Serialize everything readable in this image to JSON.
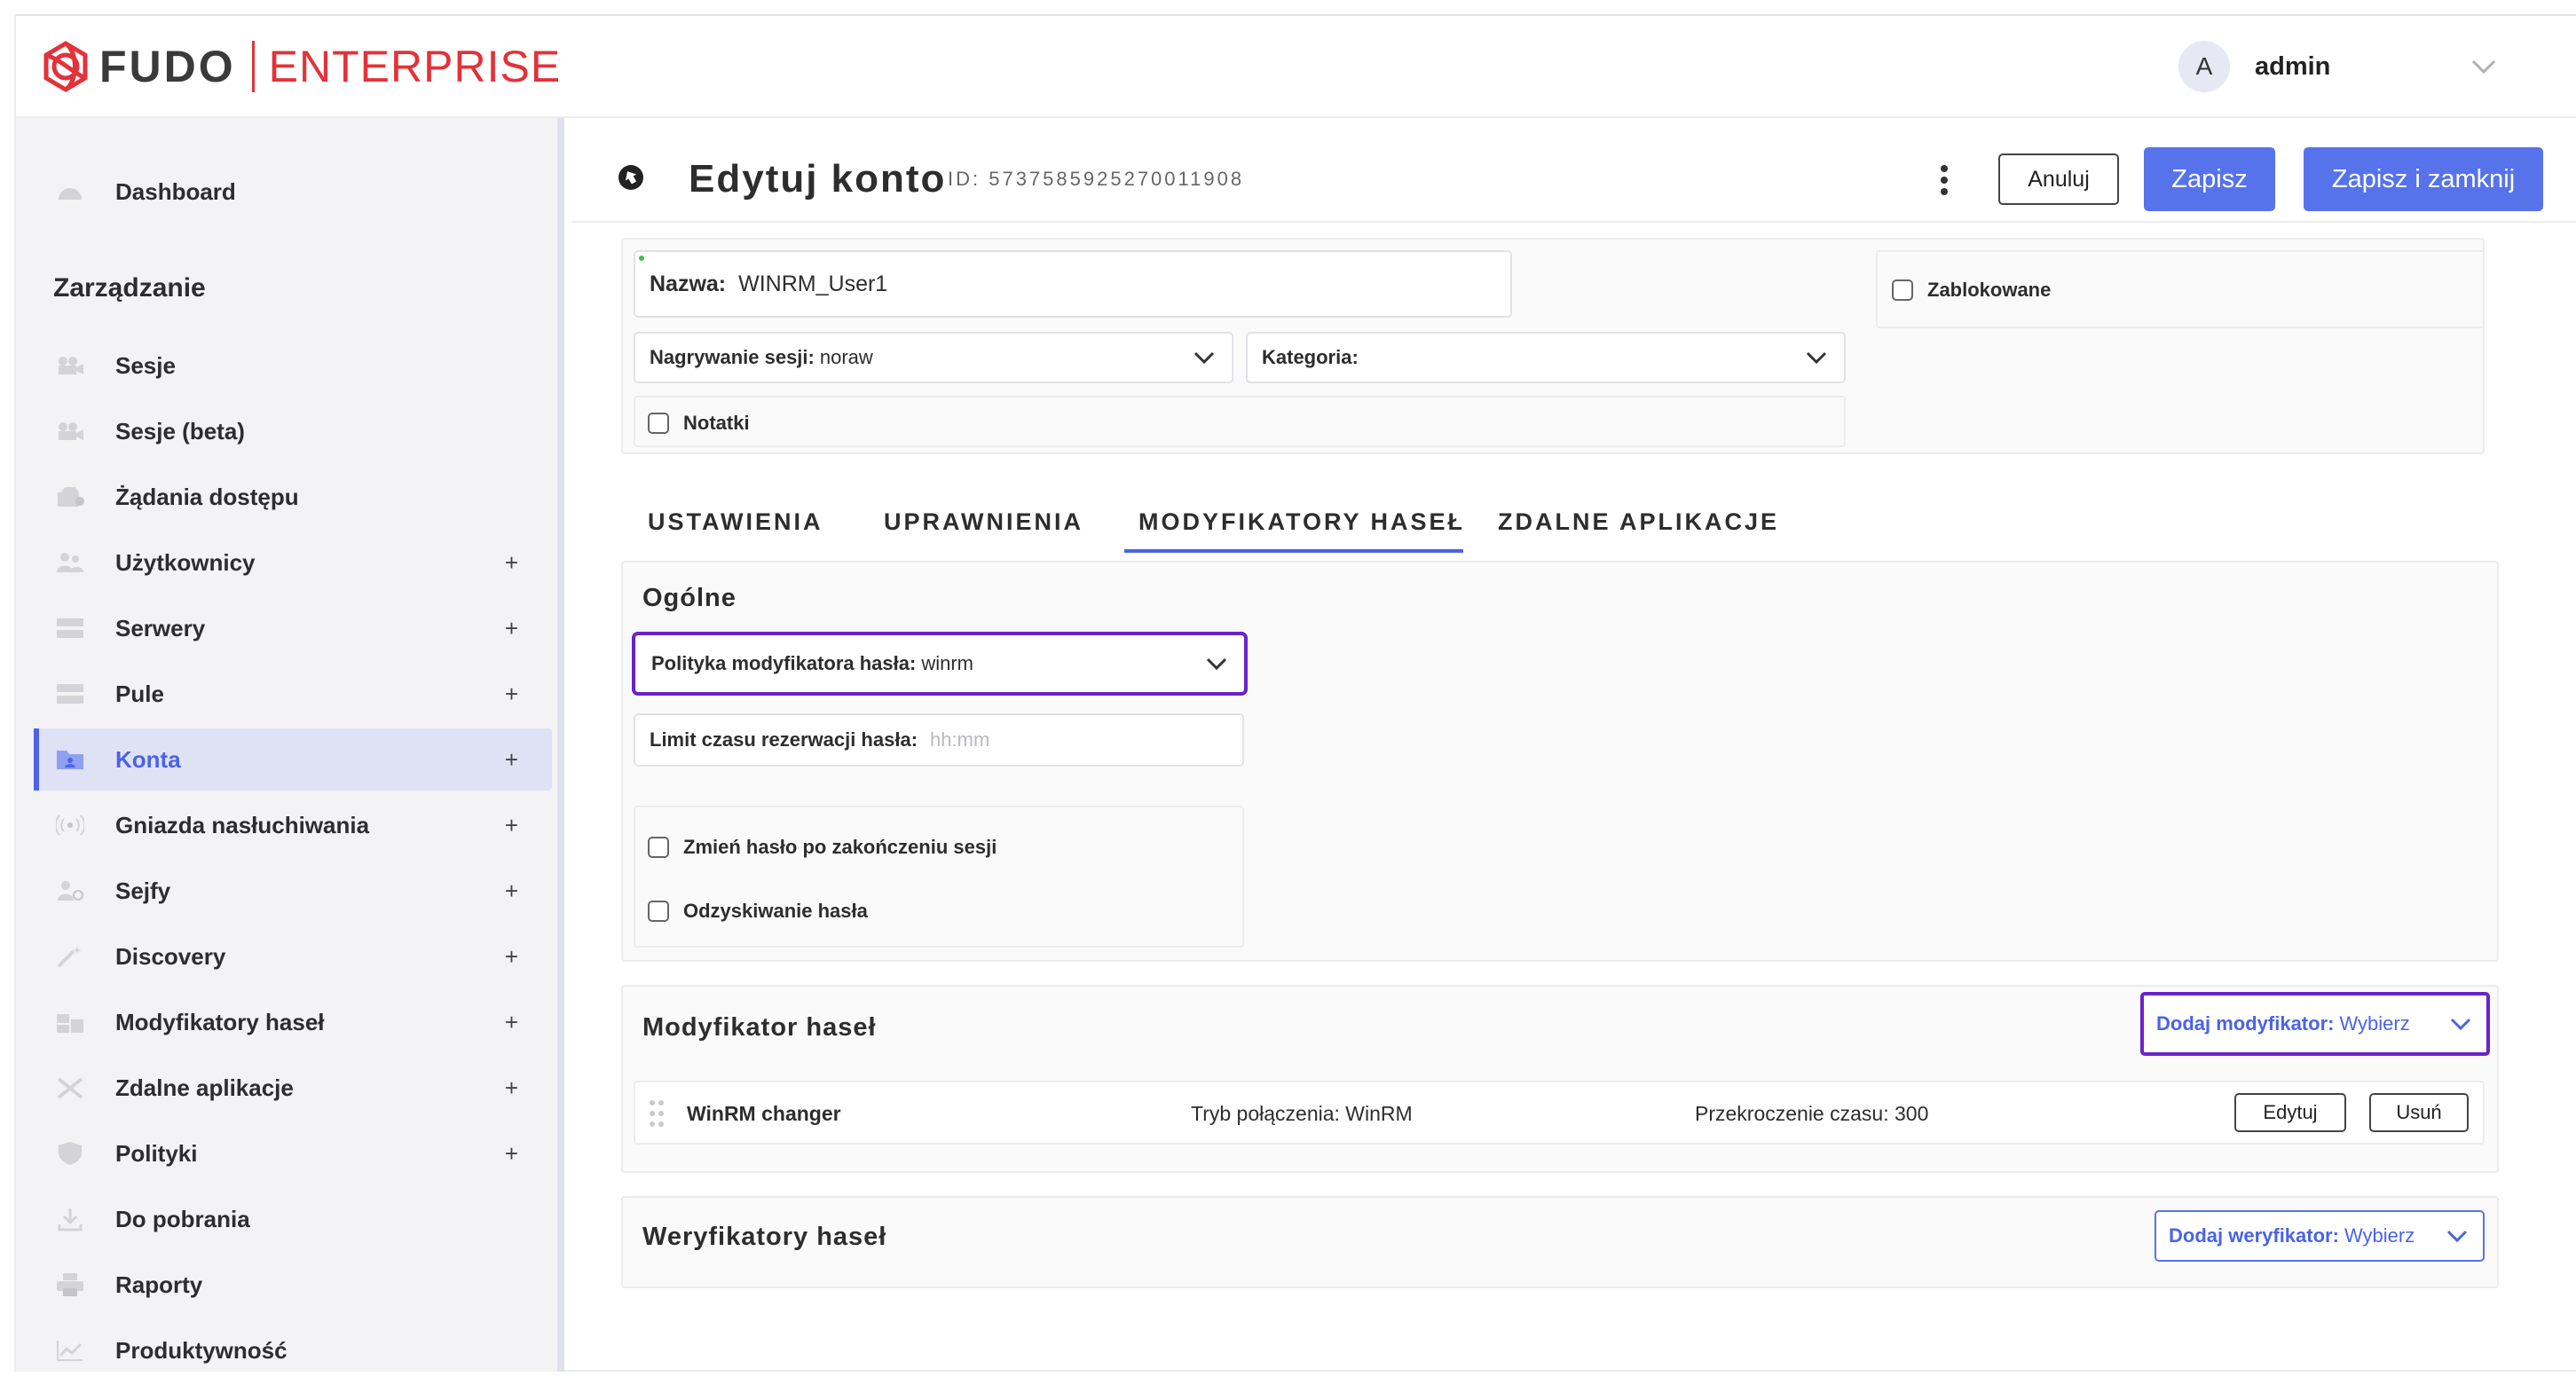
{
  "brand": {
    "name": "FUDO",
    "edition": "ENTERPRISE",
    "accent": "#e2323a"
  },
  "user": {
    "initial": "A",
    "name": "admin"
  },
  "sidebar": {
    "dashboard": "Dashboard",
    "section_title": "Zarządzanie",
    "items": [
      {
        "label": "Sesje",
        "plus": ""
      },
      {
        "label": "Sesje (beta)",
        "plus": ""
      },
      {
        "label": "Żądania dostępu",
        "plus": ""
      },
      {
        "label": "Użytkownicy",
        "plus": "+"
      },
      {
        "label": "Serwery",
        "plus": "+"
      },
      {
        "label": "Pule",
        "plus": "+"
      },
      {
        "label": "Konta",
        "plus": "+"
      },
      {
        "label": "Gniazda nasłuchiwania",
        "plus": "+"
      },
      {
        "label": "Sejfy",
        "plus": "+"
      },
      {
        "label": "Discovery",
        "plus": "+"
      },
      {
        "label": "Modyfikatory haseł",
        "plus": "+"
      },
      {
        "label": "Zdalne aplikacje",
        "plus": "+"
      },
      {
        "label": "Polityki",
        "plus": "+"
      },
      {
        "label": "Do pobrania",
        "plus": ""
      },
      {
        "label": "Raporty",
        "plus": ""
      },
      {
        "label": "Produktywność",
        "plus": ""
      }
    ]
  },
  "header": {
    "title": "Edytuj konto",
    "id_text": "ID: 5737585925270011908",
    "cancel": "Anuluj",
    "save": "Zapisz",
    "save_close": "Zapisz i zamknij"
  },
  "form": {
    "name_label": "Nazwa:",
    "name_value": "WINRM_User1",
    "blocked_label": "Zablokowane",
    "recording_label": "Nagrywanie sesji:",
    "recording_value": "noraw",
    "category_label": "Kategoria:",
    "notes_label": "Notatki"
  },
  "tabs": [
    "USTAWIENIA",
    "UPRAWNIENIA",
    "MODYFIKATORY HASEŁ",
    "ZDALNE APLIKACJE"
  ],
  "general": {
    "title": "Ogólne",
    "policy_label": "Polityka modyfikatora hasła:",
    "policy_value": "winrm",
    "limit_label": "Limit czasu rezerwacji hasła:",
    "limit_placeholder": "hh:mm",
    "change_pw_label": "Zmień hasło po zakończeniu sesji",
    "recover_label": "Odzyskiwanie hasła"
  },
  "modifiers": {
    "title": "Modyfikator haseł",
    "add_label": "Dodaj modyfikator:",
    "add_value": "Wybierz",
    "rows": [
      {
        "name": "WinRM changer",
        "mode": "Tryb połączenia: WinRM",
        "timeout": "Przekroczenie czasu: 300",
        "edit": "Edytuj",
        "delete": "Usuń"
      }
    ]
  },
  "verifiers": {
    "title": "Weryfikatory haseł",
    "add_label": "Dodaj weryfikator:",
    "add_value": "Wybierz"
  },
  "colors": {
    "primary": "#5673ec",
    "highlight": "#6a22c9",
    "active_nav_bg": "#dfe1f5"
  }
}
